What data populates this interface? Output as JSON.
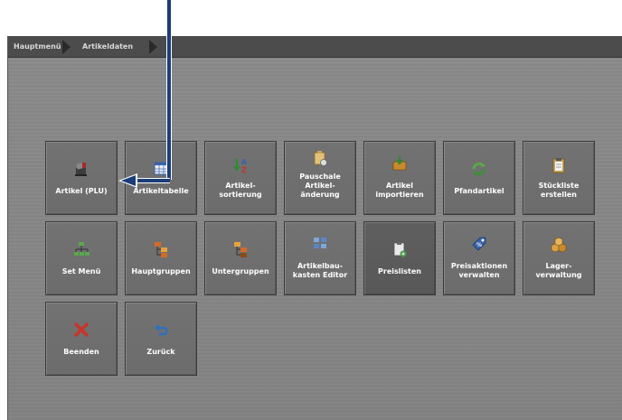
{
  "breadcrumb": {
    "items": [
      {
        "label": "Hauptmenü"
      },
      {
        "label": "Artikeldaten"
      }
    ]
  },
  "tiles": [
    {
      "label": "Artikel (PLU)",
      "icon": "cash-register-icon"
    },
    {
      "label": "Artikeltabelle",
      "icon": "table-icon"
    },
    {
      "label": "Artikel-\nsortierung",
      "icon": "sort-az-icon"
    },
    {
      "label": "Pauschale\nArtikel-\nänderung",
      "icon": "bulk-edit-icon"
    },
    {
      "label": "Artikel\nimportieren",
      "icon": "import-box-icon"
    },
    {
      "label": "Pfandartikel",
      "icon": "recycle-icon"
    },
    {
      "label": "Stückliste\nerstellen",
      "icon": "clipboard-icon"
    },
    {
      "label": "Set Menü",
      "icon": "network-icon"
    },
    {
      "label": "Hauptgruppen",
      "icon": "hierarchy-icon"
    },
    {
      "label": "Untergruppen",
      "icon": "subtree-icon"
    },
    {
      "label": "Artikelbau-\nkasten Editor",
      "icon": "modules-icon"
    },
    {
      "label": "Preislisten",
      "icon": "pricelist-icon"
    },
    {
      "label": "Preisaktionen\nverwalten",
      "icon": "price-tag-icon"
    },
    {
      "label": "Lager-\nverwaltung",
      "icon": "stock-boxes-icon"
    },
    {
      "label": "Beenden",
      "icon": "close-x-icon"
    },
    {
      "label": "Zurück",
      "icon": "back-arrow-icon"
    }
  ],
  "colors": {
    "annotation": "#1c3d78",
    "close_red": "#c8342a",
    "back_blue": "#2d6fc0"
  }
}
